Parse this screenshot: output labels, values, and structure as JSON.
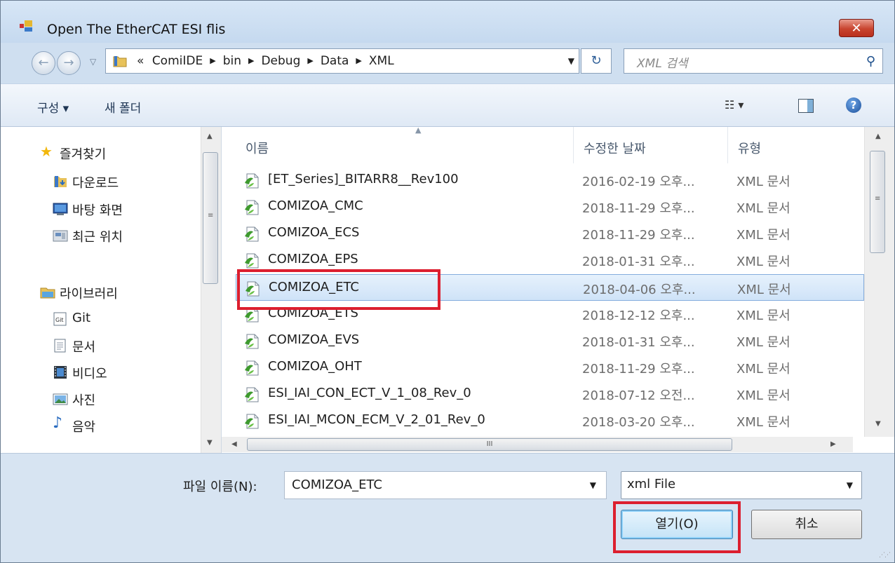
{
  "window": {
    "title": "Open The EtherCAT ESI flis",
    "close_glyph": "✕"
  },
  "nav": {
    "back_glyph": "←",
    "forward_glyph": "→",
    "breadcrumb_prefix": "«",
    "breadcrumbs": [
      "ComiIDE",
      "bin",
      "Debug",
      "Data",
      "XML"
    ],
    "refresh_glyph": "↻",
    "search_placeholder": "XML 검색",
    "search_icon": "search-icon"
  },
  "toolbar": {
    "organize": "구성 ▾",
    "new_folder": "새 폴더",
    "view_glyph": "☷ ▾",
    "help_glyph": "?"
  },
  "sidebar": {
    "favorites_label": "즐겨찾기",
    "favorites": [
      {
        "label": "다운로드",
        "icon": "download-folder-icon"
      },
      {
        "label": "바탕 화면",
        "icon": "desktop-icon"
      },
      {
        "label": "최근 위치",
        "icon": "recent-places-icon"
      }
    ],
    "libraries_label": "라이브러리",
    "libraries": [
      {
        "label": "Git",
        "icon": "git-library-icon"
      },
      {
        "label": "문서",
        "icon": "documents-icon"
      },
      {
        "label": "비디오",
        "icon": "videos-icon"
      },
      {
        "label": "사진",
        "icon": "pictures-icon"
      },
      {
        "label": "음악",
        "icon": "music-icon"
      }
    ]
  },
  "files": {
    "columns": {
      "name": "이름",
      "date": "수정한 날짜",
      "type": "유형"
    },
    "rows": [
      {
        "name": "[ET_Series]_BITARR8__Rev100",
        "date": "2016-02-19 오후...",
        "type": "XML 문서"
      },
      {
        "name": "COMIZOA_CMC",
        "date": "2018-11-29 오후...",
        "type": "XML 문서"
      },
      {
        "name": "COMIZOA_ECS",
        "date": "2018-11-29 오후...",
        "type": "XML 문서"
      },
      {
        "name": "COMIZOA_EPS",
        "date": "2018-01-31 오후...",
        "type": "XML 문서"
      },
      {
        "name": "COMIZOA_ETC",
        "date": "2018-04-06 오후...",
        "type": "XML 문서",
        "selected": true
      },
      {
        "name": "COMIZOA_ETS",
        "date": "2018-12-12 오후...",
        "type": "XML 문서"
      },
      {
        "name": "COMIZOA_EVS",
        "date": "2018-01-31 오후...",
        "type": "XML 문서"
      },
      {
        "name": "COMIZOA_OHT",
        "date": "2018-11-29 오후...",
        "type": "XML 문서"
      },
      {
        "name": "ESI_IAI_CON_ECT_V_1_08_Rev_0",
        "date": "2018-07-12 오전...",
        "type": "XML 문서"
      },
      {
        "name": "ESI_IAI_MCON_ECM_V_2_01_Rev_0",
        "date": "2018-03-20 오후...",
        "type": "XML 문서"
      }
    ],
    "hscroll_grip": "III"
  },
  "bottom": {
    "filename_label": "파일 이름(N):",
    "filename_value": "COMIZOA_ETC",
    "filetype_value": "xml File",
    "open_button": "열기(O)",
    "cancel_button": "취소"
  },
  "colors": {
    "highlight": "#dc1f2f",
    "selection": "#cfe3f8",
    "close_button": "#c8442f"
  }
}
